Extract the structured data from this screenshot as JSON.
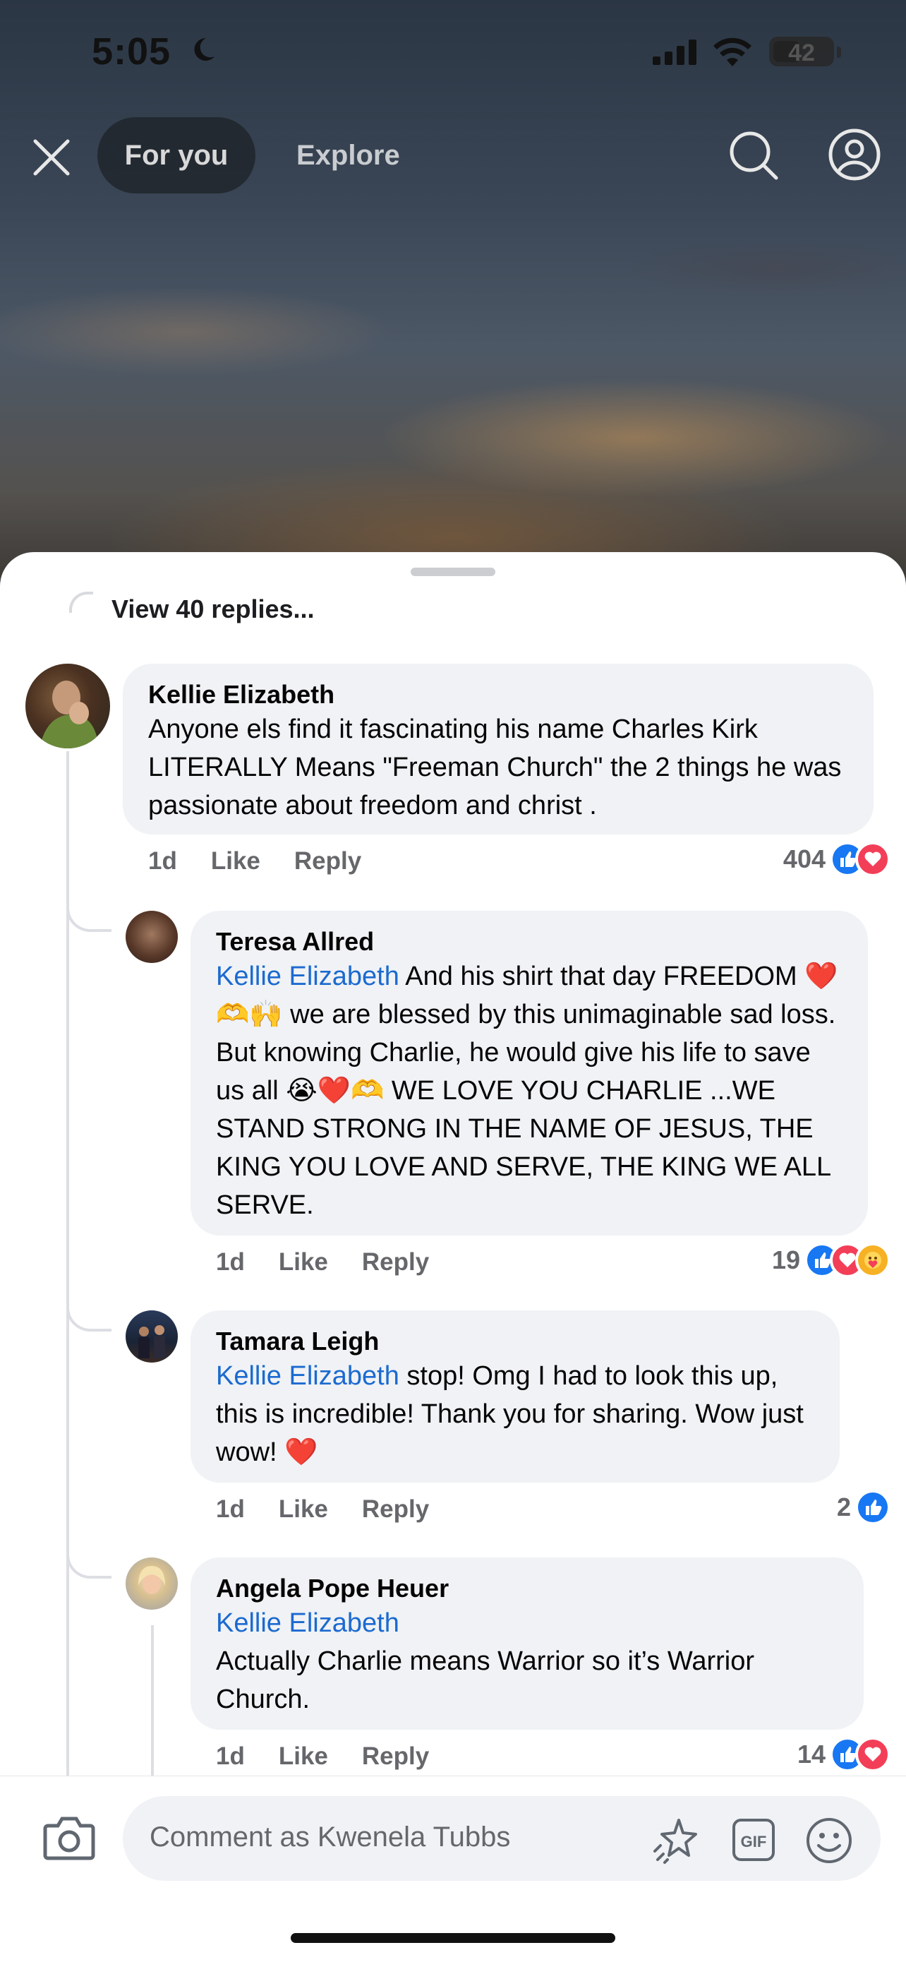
{
  "status_bar": {
    "time": "5:05",
    "battery": "42"
  },
  "nav": {
    "tab_active": "For you",
    "tab_other": "Explore"
  },
  "thread": {
    "view_replies": "View 40 replies..."
  },
  "comments": [
    {
      "author": "Kellie Elizabeth",
      "text": "Anyone els find it fascinating his name Charles Kirk LITERALLY Means \"Freeman Church\" the 2 things he was passionate about freedom and christ .",
      "time": "1d",
      "like_label": "Like",
      "reply_label": "Reply",
      "reaction_count": "404",
      "reactions": [
        "like",
        "love"
      ]
    },
    {
      "author": "Teresa Allred",
      "mention": "Kellie Elizabeth",
      "text": " And his shirt that day FREEDOM ❤️🫶🙌 we are blessed by this unimaginable sad loss. But knowing Charlie, he would give his life to save us all 😭❤️🫶 WE LOVE YOU CHARLIE ...WE STAND STRONG IN THE NAME OF JESUS, THE KING YOU LOVE AND SERVE, THE KING WE ALL SERVE.",
      "time": "1d",
      "like_label": "Like",
      "reply_label": "Reply",
      "reaction_count": "19",
      "reactions": [
        "like",
        "love",
        "care"
      ]
    },
    {
      "author": "Tamara Leigh",
      "mention": "Kellie Elizabeth",
      "text": " stop! Omg I had to look this up, this is incredible! Thank you for sharing. Wow just wow! ❤️",
      "time": "1d",
      "like_label": "Like",
      "reply_label": "Reply",
      "reaction_count": "2",
      "reactions": [
        "like"
      ]
    },
    {
      "author": "Angela Pope Heuer",
      "mention": "Kellie Elizabeth",
      "text": "Actually Charlie means Warrior so it’s Warrior Church.",
      "time": "1d",
      "like_label": "Like",
      "reply_label": "Reply",
      "reaction_count": "14",
      "reactions": [
        "like",
        "love"
      ]
    }
  ],
  "composer": {
    "placeholder": "Comment as Kwenela Tubbs"
  },
  "colors": {
    "mention": "#1b6ad0",
    "like": "#1877f2",
    "love": "#f33e58",
    "bubble": "#f0f2f5"
  }
}
